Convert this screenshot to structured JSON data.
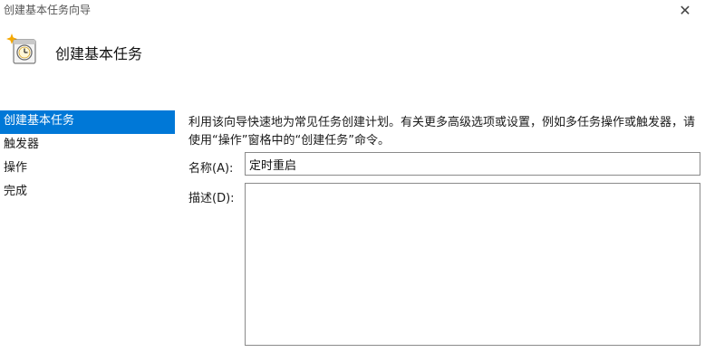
{
  "window": {
    "title": "创建基本任务向导",
    "close_glyph": "✕"
  },
  "header": {
    "icon": "scheduled-task-clock-icon",
    "title": "创建基本任务"
  },
  "steps": [
    {
      "label": "创建基本任务",
      "active": true
    },
    {
      "label": "触发器",
      "active": false
    },
    {
      "label": "操作",
      "active": false
    },
    {
      "label": "完成",
      "active": false
    }
  ],
  "main": {
    "intro": "利用该向导快速地为常见任务创建计划。有关更多高级选项或设置，例如多任务操作或触发器，请使用“操作”窗格中的“创建任务”命令。",
    "name_label": "名称(A):",
    "name_value": "定时重启",
    "description_label": "描述(D):",
    "description_value": ""
  },
  "colors": {
    "accent": "#0078d7"
  }
}
